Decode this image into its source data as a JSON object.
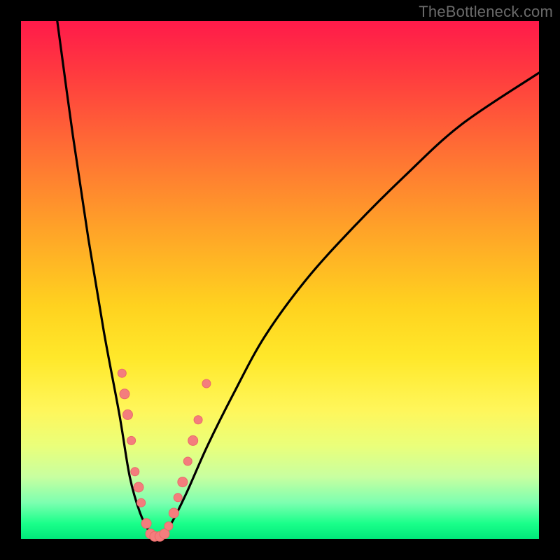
{
  "watermark": "TheBottleneck.com",
  "colors": {
    "frame": "#000000",
    "curve": "#000000",
    "marker_fill": "#f47d7d",
    "marker_stroke": "#e96a6a"
  },
  "chart_data": {
    "type": "line",
    "title": "",
    "xlabel": "",
    "ylabel": "",
    "xlim": [
      0,
      100
    ],
    "ylim": [
      0,
      100
    ],
    "grid": false,
    "legend": false,
    "note": "V-shaped bottleneck curve; minimum sits around x≈25–27 at y≈0. Left branch rises to top at x≈7, right branch rises toward y≈90 at x=100.",
    "series": [
      {
        "name": "curve",
        "x": [
          7,
          10,
          13,
          16,
          19,
          21,
          23,
          25,
          26,
          27,
          29,
          32,
          36,
          41,
          47,
          55,
          64,
          74,
          85,
          100
        ],
        "y": [
          100,
          78,
          58,
          40,
          24,
          12,
          5,
          1,
          0,
          0.5,
          3,
          9,
          18,
          28,
          39,
          50,
          60,
          70,
          80,
          90
        ]
      }
    ],
    "markers": [
      {
        "x": 19.5,
        "y": 32,
        "r": 6
      },
      {
        "x": 20.0,
        "y": 28,
        "r": 7
      },
      {
        "x": 20.6,
        "y": 24,
        "r": 7
      },
      {
        "x": 21.3,
        "y": 19,
        "r": 6
      },
      {
        "x": 22.0,
        "y": 13,
        "r": 6
      },
      {
        "x": 22.7,
        "y": 10,
        "r": 7
      },
      {
        "x": 23.2,
        "y": 7,
        "r": 6
      },
      {
        "x": 24.2,
        "y": 3,
        "r": 7
      },
      {
        "x": 25.0,
        "y": 1,
        "r": 7
      },
      {
        "x": 25.8,
        "y": 0.5,
        "r": 7
      },
      {
        "x": 26.8,
        "y": 0.5,
        "r": 7
      },
      {
        "x": 27.7,
        "y": 1,
        "r": 7
      },
      {
        "x": 28.5,
        "y": 2.5,
        "r": 6
      },
      {
        "x": 29.5,
        "y": 5,
        "r": 7
      },
      {
        "x": 30.3,
        "y": 8,
        "r": 6
      },
      {
        "x": 31.2,
        "y": 11,
        "r": 7
      },
      {
        "x": 32.2,
        "y": 15,
        "r": 6
      },
      {
        "x": 33.2,
        "y": 19,
        "r": 7
      },
      {
        "x": 34.2,
        "y": 23,
        "r": 6
      },
      {
        "x": 35.8,
        "y": 30,
        "r": 6
      }
    ]
  }
}
